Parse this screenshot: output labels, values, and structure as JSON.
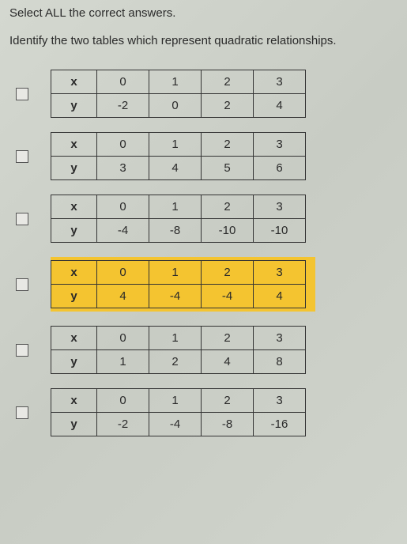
{
  "instruction": "Select ALL the correct answers.",
  "prompt": "Identify the two tables which represent quadratic relationships.",
  "row_labels": {
    "x": "x",
    "y": "y"
  },
  "choices": [
    {
      "highlighted": false,
      "x": [
        "0",
        "1",
        "2",
        "3"
      ],
      "y": [
        "-2",
        "0",
        "2",
        "4"
      ]
    },
    {
      "highlighted": false,
      "x": [
        "0",
        "1",
        "2",
        "3"
      ],
      "y": [
        "3",
        "4",
        "5",
        "6"
      ]
    },
    {
      "highlighted": false,
      "x": [
        "0",
        "1",
        "2",
        "3"
      ],
      "y": [
        "-4",
        "-8",
        "-10",
        "-10"
      ]
    },
    {
      "highlighted": true,
      "x": [
        "0",
        "1",
        "2",
        "3"
      ],
      "y": [
        "4",
        "-4",
        "-4",
        "4"
      ]
    },
    {
      "highlighted": false,
      "x": [
        "0",
        "1",
        "2",
        "3"
      ],
      "y": [
        "1",
        "2",
        "4",
        "8"
      ]
    },
    {
      "highlighted": false,
      "x": [
        "0",
        "1",
        "2",
        "3"
      ],
      "y": [
        "-2",
        "-4",
        "-8",
        "-16"
      ]
    }
  ]
}
